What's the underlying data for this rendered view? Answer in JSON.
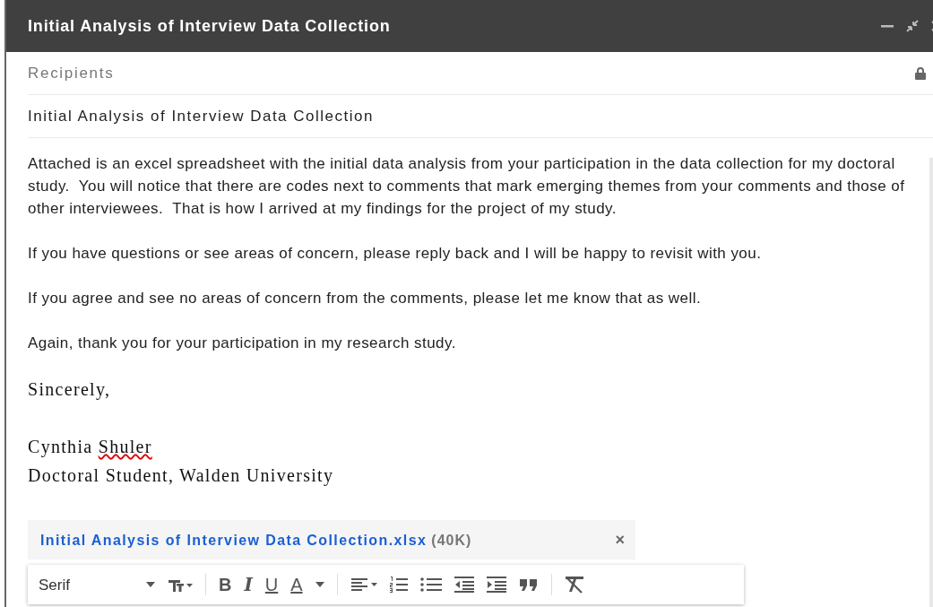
{
  "window": {
    "title": "Initial Analysis of Interview Data Collection"
  },
  "recipients": {
    "placeholder": "Recipients"
  },
  "subject": {
    "value": "Initial Analysis of Interview Data Collection"
  },
  "body": {
    "paragraphs": [
      "Attached is an excel spreadsheet with the initial data analysis from your participation in the data collection for my doctoral study.  You will notice that there are codes next to comments that mark emerging themes from your comments and those of other interviewees.  That is how I arrived at my findings for the project of my study.",
      "If you have questions or see areas of concern, please reply back and I will be happy to revisit with you.",
      "If you agree and see no areas of concern from the comments, please let me know that as well.",
      "Again, thank you for your participation in my research study."
    ],
    "closing": "Sincerely,",
    "signature": [
      [
        {
          "text": "Cynthia ",
          "misspelled": false
        },
        {
          "text": "Shuler",
          "misspelled": true
        }
      ],
      [
        {
          "text": "Doctoral Student, Walden University",
          "misspelled": false
        }
      ]
    ]
  },
  "attachment": {
    "name": "Initial Analysis of Interview Data Collection.xlsx",
    "size": "(40K)",
    "remove": "×"
  },
  "toolbar": {
    "font": "Serif",
    "items": [
      {
        "kind": "icon"
      },
      {
        "kind": "sep"
      },
      {
        "kind": "letter",
        "label": "B"
      },
      {
        "kind": "letter",
        "label": "I"
      },
      {
        "kind": "letter",
        "label": "U"
      },
      {
        "kind": "letter",
        "label": "A"
      },
      {
        "kind": "sep"
      },
      {
        "kind": "icon"
      },
      {
        "kind": "icon"
      },
      {
        "kind": "icon"
      },
      {
        "kind": "icon"
      },
      {
        "kind": "icon"
      },
      {
        "kind": "icon"
      },
      {
        "kind": "sep"
      },
      {
        "kind": "icon"
      }
    ]
  }
}
